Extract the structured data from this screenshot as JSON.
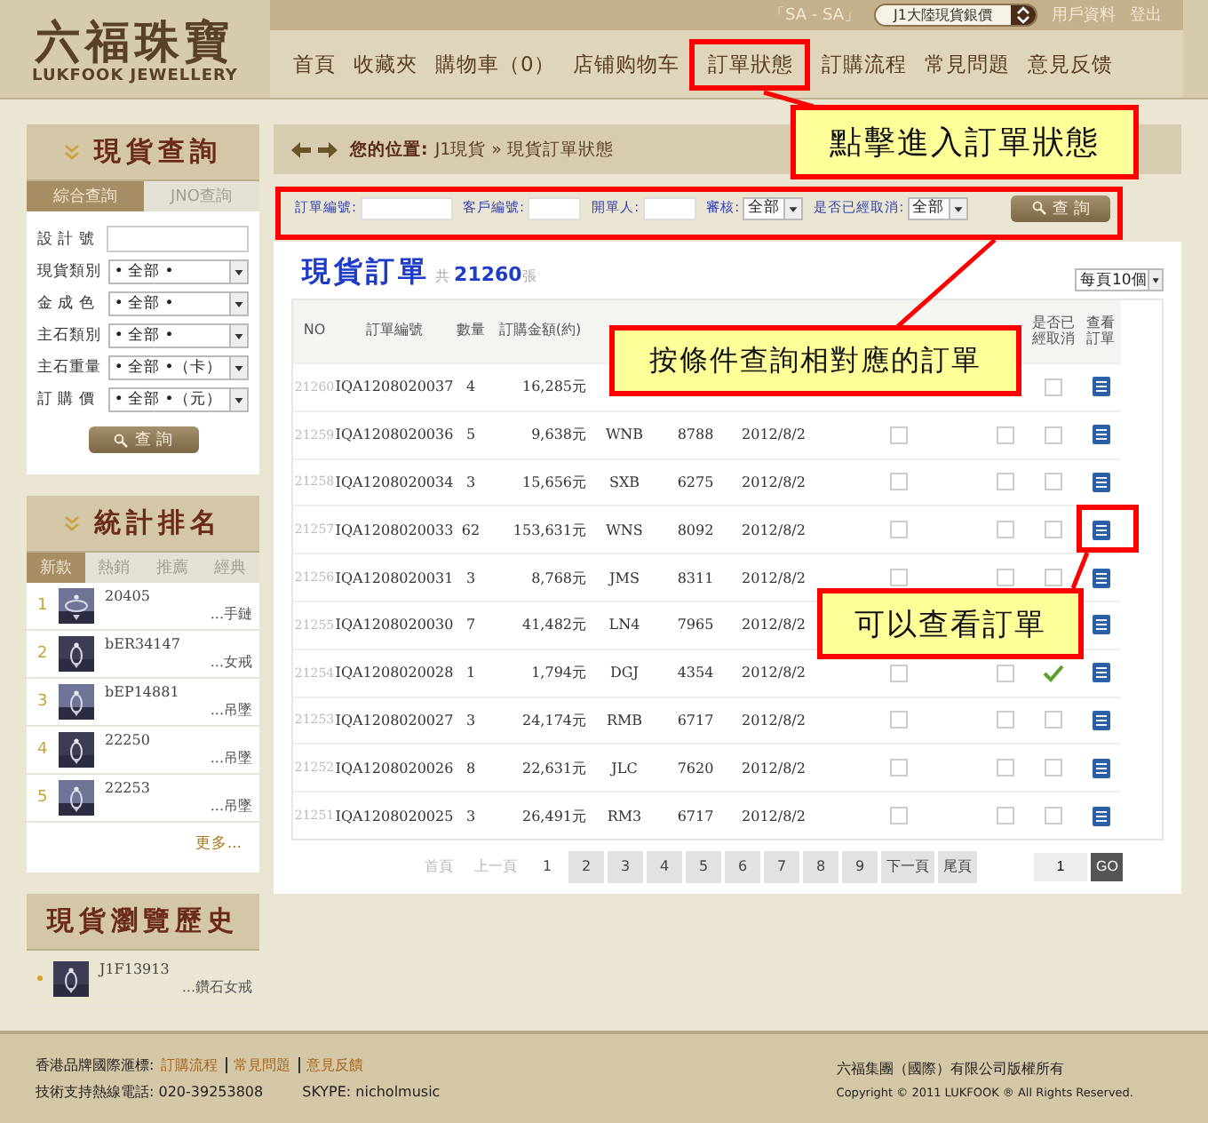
{
  "header": {
    "logo_cn": "六福珠寶",
    "logo_en": "LUKFOOK JEWELLERY",
    "account_code": "「SA - SA」",
    "price_select": "J1大陸現貨銀價",
    "links": [
      "用戶資料",
      "登出"
    ]
  },
  "nav": [
    "首頁",
    "收藏夾",
    "購物車（0）",
    "店铺购物车",
    "訂單狀態",
    "訂購流程",
    "常見問題",
    "意見反馈"
  ],
  "sidebar": {
    "search": {
      "title": "現貨查詢",
      "tabs": [
        {
          "label": "綜合查詢",
          "selected": true
        },
        {
          "label": "JNO查詢",
          "selected": false
        }
      ],
      "fields": [
        {
          "label": "設 計 號",
          "kind": "input"
        },
        {
          "label": "現貨類別",
          "kind": "select",
          "value": "• 全部 •"
        },
        {
          "label": "金 成 色",
          "kind": "select",
          "value": "• 全部 •"
        },
        {
          "label": "主石類別",
          "kind": "select",
          "value": "• 全部 •"
        },
        {
          "label": "主石重量",
          "kind": "select",
          "value": "• 全部 •（卡）"
        },
        {
          "label": "訂 購 價",
          "kind": "select",
          "value": "• 全部 •（元）"
        }
      ],
      "button": "查 詢"
    },
    "ranking": {
      "title": "統計排名",
      "tabs": [
        {
          "label": "新款",
          "selected": true
        },
        {
          "label": "熱銷",
          "selected": false
        },
        {
          "label": "推薦",
          "selected": false
        },
        {
          "label": "經典",
          "selected": false
        }
      ],
      "items": [
        {
          "rank": "1",
          "code": "20405",
          "category": "...手鏈"
        },
        {
          "rank": "2",
          "code": "bER34147",
          "category": "...女戒"
        },
        {
          "rank": "3",
          "code": "bEP14881",
          "category": "...吊墜"
        },
        {
          "rank": "4",
          "code": "22250",
          "category": "...吊墜"
        },
        {
          "rank": "5",
          "code": "22253",
          "category": "...吊墜"
        }
      ],
      "more": "更多..."
    },
    "history": {
      "title": "現貨瀏覽歷史",
      "items": [
        {
          "code": "J1F13913",
          "category": "...鑽石女戒"
        }
      ]
    }
  },
  "breadcrumb": {
    "label": "您的位置:",
    "path": "J1現貨 » 現貨訂單狀態"
  },
  "filters": {
    "fields": [
      {
        "label": "訂單編號:",
        "kind": "input"
      },
      {
        "label": "客戶編號:",
        "kind": "input"
      },
      {
        "label": "開單人:",
        "kind": "input"
      },
      {
        "label": "審核:",
        "kind": "select",
        "value": "全部"
      },
      {
        "label": "是否已經取消:",
        "kind": "select",
        "value": "全部"
      }
    ],
    "button": "查 詢"
  },
  "orders": {
    "title": "現貨訂單",
    "total_prefix": "共",
    "total": "21260",
    "total_suffix": "張",
    "page_size": "每頁10個",
    "columns": {
      "no": "NO",
      "order_no": "訂單編號",
      "qty": "數量",
      "amount": "訂購金額(約)",
      "cancelled": "是否已經取消",
      "view": "查看訂單"
    },
    "rows": [
      {
        "no": "21260",
        "order_no": "IQA1208020037",
        "qty": "4",
        "amount": "16,285元",
        "cancelled": false
      },
      {
        "no": "21259",
        "order_no": "IQA1208020036",
        "qty": "5",
        "amount": "9,638元",
        "code": "WNB",
        "number": "8788",
        "date": "2012/8/2",
        "check_a": false,
        "check_b": false,
        "cancelled": false
      },
      {
        "no": "21258",
        "order_no": "IQA1208020034",
        "qty": "3",
        "amount": "15,656元",
        "code": "SXB",
        "number": "6275",
        "date": "2012/8/2",
        "check_a": false,
        "check_b": false,
        "cancelled": false
      },
      {
        "no": "21257",
        "order_no": "IQA1208020033",
        "qty": "62",
        "amount": "153,631元",
        "code": "WNS",
        "number": "8092",
        "date": "2012/8/2",
        "check_a": false,
        "check_b": false,
        "cancelled": false
      },
      {
        "no": "21256",
        "order_no": "IQA1208020031",
        "qty": "3",
        "amount": "8,768元",
        "code": "JMS",
        "number": "8311",
        "date": "2012/8/2",
        "check_a": false,
        "check_b": false,
        "cancelled": false
      },
      {
        "no": "21255",
        "order_no": "IQA1208020030",
        "qty": "7",
        "amount": "41,482元",
        "code": "LN4",
        "number": "7965",
        "date": "2012/8/2"
      },
      {
        "no": "21254",
        "order_no": "IQA1208020028",
        "qty": "1",
        "amount": "1,794元",
        "code": "DGJ",
        "number": "4354",
        "date": "2012/8/2",
        "check_a": false,
        "check_b": false,
        "cancelled": true
      },
      {
        "no": "21253",
        "order_no": "IQA1208020027",
        "qty": "3",
        "amount": "24,174元",
        "code": "RMB",
        "number": "6717",
        "date": "2012/8/2",
        "check_a": false,
        "check_b": false,
        "cancelled": false
      },
      {
        "no": "21252",
        "order_no": "IQA1208020026",
        "qty": "8",
        "amount": "22,631元",
        "code": "JLC",
        "number": "7620",
        "date": "2012/8/2",
        "check_a": false,
        "check_b": false,
        "cancelled": false
      },
      {
        "no": "21251",
        "order_no": "IQA1208020025",
        "qty": "3",
        "amount": "26,491元",
        "code": "RM3",
        "number": "6717",
        "date": "2012/8/2",
        "check_a": false,
        "check_b": false,
        "cancelled": false
      }
    ]
  },
  "pagination": {
    "first": "首頁",
    "prev": "上一頁",
    "pages": [
      {
        "label": "1",
        "selected": true
      },
      {
        "label": "2",
        "selected": false
      },
      {
        "label": "3",
        "selected": false
      },
      {
        "label": "4",
        "selected": false
      },
      {
        "label": "5",
        "selected": false
      },
      {
        "label": "6",
        "selected": false
      },
      {
        "label": "7",
        "selected": false
      },
      {
        "label": "8",
        "selected": false
      },
      {
        "label": "9",
        "selected": false
      }
    ],
    "next": "下一頁",
    "last": "尾頁",
    "jump_value": "1",
    "go": "GO"
  },
  "annotations": [
    {
      "text": "點擊進入訂單狀態"
    },
    {
      "text": "按條件查詢相對應的訂單"
    },
    {
      "text": "可以查看訂單"
    }
  ],
  "footer": {
    "hotline_label": "香港品牌國際滙標:",
    "links": [
      "訂購流程",
      "常見問題",
      "意見反饋"
    ],
    "phone": "技術支持熱線電話: 020-39253808",
    "skype": "SKYPE: nicholmusic",
    "company": "六福集團（國際）有限公司版權所有",
    "copyright": "Copyright © 2011 LUKFOOK ® All Rights Reserved."
  }
}
